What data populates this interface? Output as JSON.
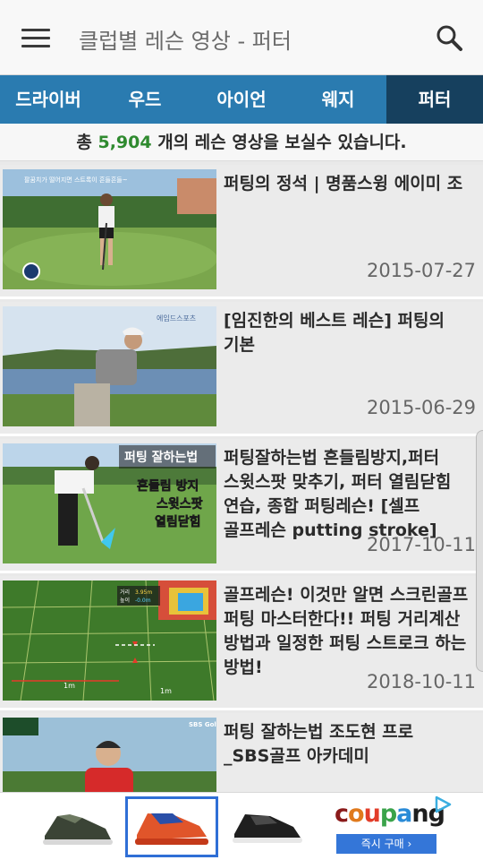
{
  "app": {
    "title": "클럽별 레슨 영상 - 퍼터",
    "icons": {
      "menu": "hamburger-menu-icon",
      "search": "search-icon"
    }
  },
  "tabs": [
    {
      "label": "드라이버",
      "active": false
    },
    {
      "label": "우드",
      "active": false
    },
    {
      "label": "아이언",
      "active": false
    },
    {
      "label": "웨지",
      "active": false
    },
    {
      "label": "퍼터",
      "active": true
    }
  ],
  "summary": {
    "prefix": "총",
    "count": "5,904",
    "suffix": "개의 레슨 영상을 보실수 있습니다."
  },
  "videos": [
    {
      "title": "퍼팅의 정석 | 명품스윙 에이미 조",
      "date": "2015-07-27",
      "thumb_caption": "팔꿈치가 떨어지면 스트록이 흔들흔들~"
    },
    {
      "title": "[임진한의 베스트 레슨] 퍼팅의 기본",
      "date": "2015-06-29",
      "thumb_caption": "에임드스포츠"
    },
    {
      "title": "퍼팅잘하는법 흔들림방지,퍼터 스윗스팟 맞추기, 퍼터 열림닫힘 연습, 종합 퍼팅레슨! [셀프 골프레슨 putting stroke]",
      "date": "2017-10-11",
      "thumb_caption_1": "퍼팅 잘하는법",
      "thumb_caption_2": "흔들림 방지",
      "thumb_caption_3": "스윗스팟",
      "thumb_caption_4": "열림닫힘"
    },
    {
      "title": "골프레슨! 이것만 알면 스크린골프 퍼팅 마스터한다!! 퍼팅 거리계산 방법과 일정한 퍼팅 스트로크 하는 방법!",
      "date": "2018-10-11",
      "thumb_label_1": "거리",
      "thumb_value_1": "3.95m",
      "thumb_label_2": "높이",
      "thumb_value_2": "-0.0m",
      "thumb_mark_1": "1m",
      "thumb_mark_2": "1m"
    },
    {
      "title": "퍼팅 잘하는법 조도현 프로_SBS골프 아카데미",
      "date": "",
      "thumb_caption": "SBS Golf"
    }
  ],
  "ad": {
    "brand": "coupang",
    "brand_button": "즉시 구매 ›",
    "products": [
      "shoe-gray",
      "shoe-orange-selected",
      "shoe-black"
    ],
    "icons": {
      "ad_choices": "ad-play-icon"
    }
  },
  "colors": {
    "tab_bar": "#2a7bb0",
    "tab_active": "#16405e",
    "count_highlight": "#2f8a2f",
    "coupang_button": "#3476d8"
  }
}
